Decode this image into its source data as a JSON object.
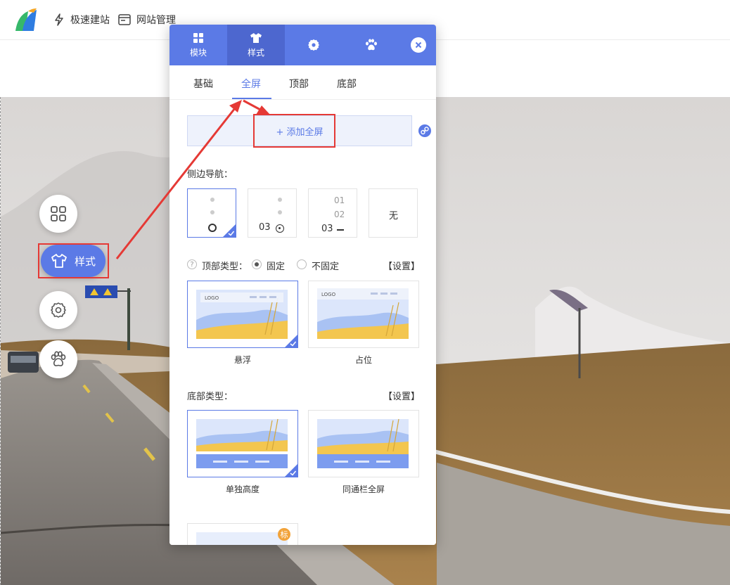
{
  "topbar": {
    "quick_build": "极速建站",
    "site_manage": "网站管理"
  },
  "toolbar": {
    "active_label": "样式"
  },
  "panel": {
    "tabs": [
      {
        "label": "模块",
        "icon": "grid-icon"
      },
      {
        "label": "样式",
        "icon": "shirt-icon"
      },
      {
        "label": "",
        "icon": "gear-icon"
      },
      {
        "label": "",
        "icon": "paw-icon"
      }
    ],
    "subtabs": [
      "基础",
      "全屏",
      "顶部",
      "底部"
    ],
    "active_subtab": "全屏",
    "add_fullscreen": "+ 添加全屏",
    "side_nav_label": "侧边导航：",
    "side_nav_options": [
      {
        "line1": "",
        "line2": "",
        "line3": ""
      },
      {
        "line1": "",
        "line2": "",
        "line3": "03"
      },
      {
        "line1": "01",
        "line2": "02",
        "line3": "03"
      },
      {
        "line1": "",
        "line2": "",
        "line3": "无"
      }
    ],
    "top_type_label": "顶部类型：",
    "top_type_fixed": "固定",
    "top_type_unfixed": "不固定",
    "settings": "【设置】",
    "logo_text": "LOGO",
    "top_options": [
      "悬浮",
      "占位"
    ],
    "bottom_type_label": "底部类型：",
    "bottom_options": [
      "单独高度",
      "同通栏全屏"
    ],
    "badge": "标"
  },
  "colors": {
    "accent": "#5b7ae6",
    "highlight": "#e53935"
  }
}
